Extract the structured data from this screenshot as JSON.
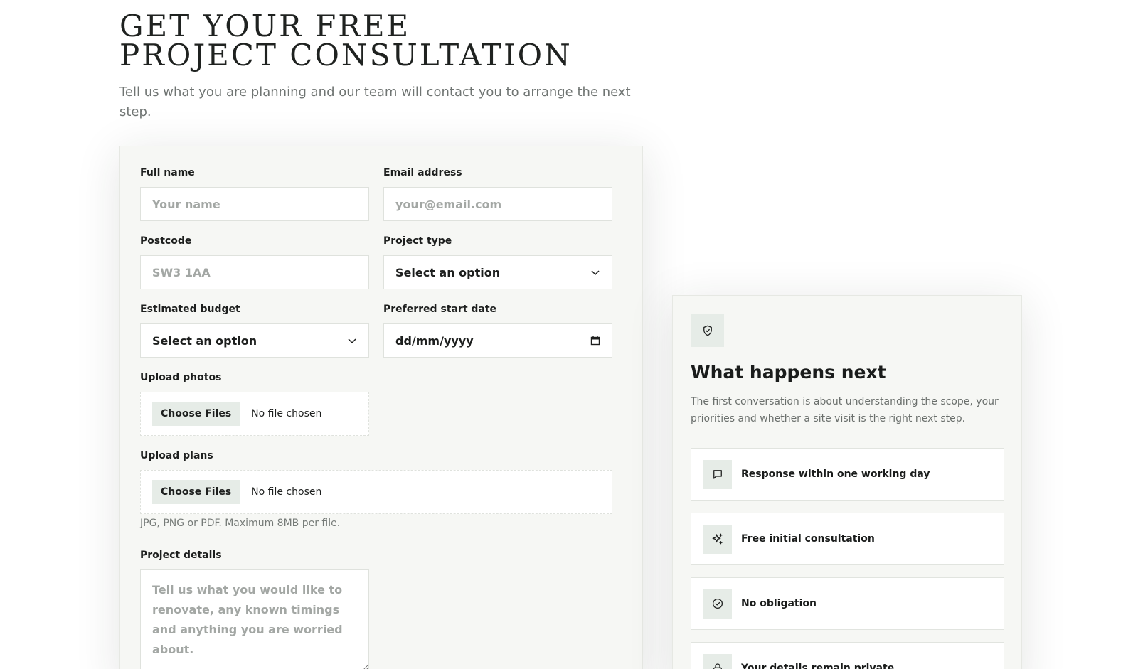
{
  "hero": {
    "title_line1": "GET YOUR FREE",
    "title_line2": "PROJECT CONSULTATION",
    "subtitle": "Tell us what you are planning and our team will contact you to arrange the next step."
  },
  "form": {
    "full_name": {
      "label": "Full name",
      "placeholder": "Your name"
    },
    "email": {
      "label": "Email address",
      "placeholder": "your@email.com"
    },
    "postcode": {
      "label": "Postcode",
      "placeholder": "SW3 1AA"
    },
    "project_type": {
      "label": "Project type",
      "selected": "Select an option"
    },
    "budget": {
      "label": "Estimated budget",
      "selected": "Select an option"
    },
    "start_date": {
      "label": "Preferred start date",
      "value": "dd/mm/yyyy"
    },
    "upload_photos": {
      "label": "Upload photos",
      "button": "Choose Files",
      "status": "No file chosen"
    },
    "upload_plans": {
      "label": "Upload plans",
      "button": "Choose Files",
      "status": "No file chosen"
    },
    "upload_hint": "JPG, PNG or PDF. Maximum 8MB per file.",
    "details": {
      "label": "Project details",
      "placeholder": "Tell us what you would like to renovate, any known timings and anything you are worried about."
    }
  },
  "info": {
    "icon": "shield-check-icon",
    "title": "What happens next",
    "text": "The first conversation is about understanding the scope, your priorities and whether a site visit is the right next step.",
    "benefits": [
      {
        "icon": "message-icon",
        "label": "Response within one working day"
      },
      {
        "icon": "sparkle-icon",
        "label": "Free initial consultation"
      },
      {
        "icon": "check-circle-icon",
        "label": "No obligation"
      },
      {
        "icon": "lock-icon",
        "label": "Your details remain private"
      }
    ]
  },
  "colors": {
    "card_bg": "#f6f7f4",
    "icon_bg": "#e6ece7",
    "text_dark": "#1d1f1e",
    "text_muted": "#707573"
  }
}
